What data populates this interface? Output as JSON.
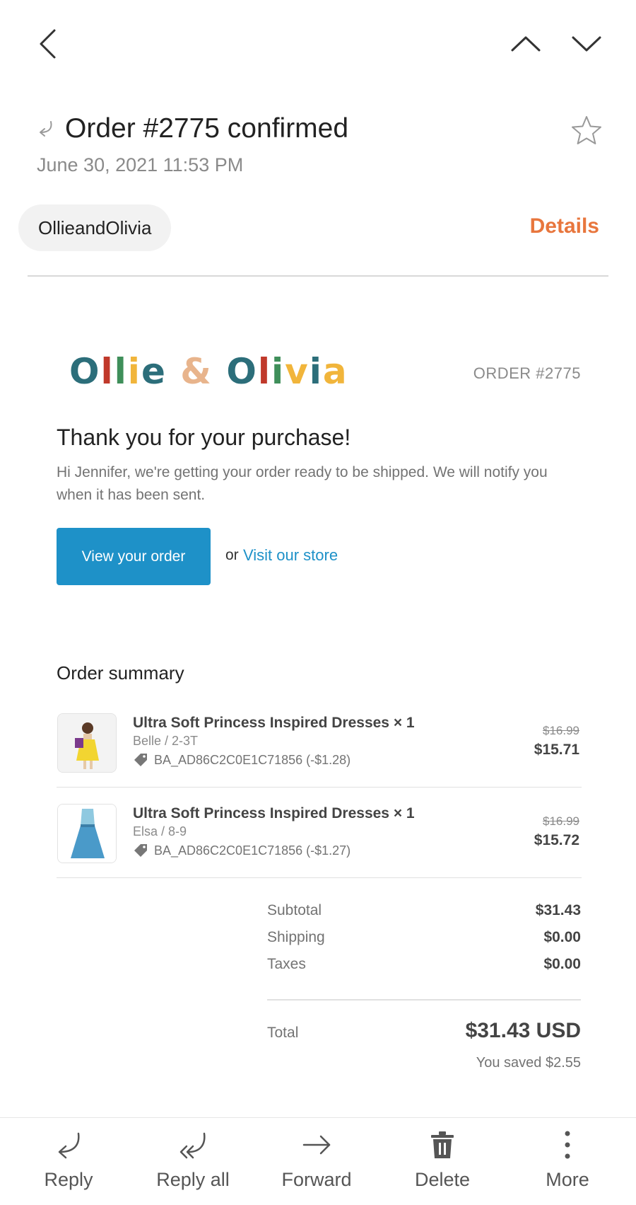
{
  "email": {
    "subject": "Order #2775 confirmed",
    "date": "June 30, 2021  11:53 PM",
    "sender": "OllieandOlivia",
    "details_label": "Details"
  },
  "message": {
    "logo": {
      "text": "Ollie & Olivia",
      "letter_colors": [
        "#2c6e7a",
        "#c0392b",
        "#3f8f5a",
        "#f1b53b",
        "#2c6e7a",
        "#e8b48c",
        "#2c6e7a",
        "#c0392b",
        "#3f8f5a",
        "#f1b53b",
        "#2c6e7a",
        "#f1b53b"
      ]
    },
    "order_label": "ORDER #2775",
    "heading": "Thank you for your purchase!",
    "body": "Hi Jennifer, we're getting your order ready to be shipped. We will notify you when it has been sent.",
    "view_order_label": "View your order",
    "or_text": "or",
    "store_link_label": "Visit our store",
    "summary_title": "Order summary",
    "items": [
      {
        "name": "Ultra Soft Princess Inspired Dresses × 1",
        "variant": "Belle / 2-3T",
        "discount": "BA_AD86C2C0E1C71856 (-$1.28)",
        "original_price": "$16.99",
        "price": "$15.71",
        "image": "girl-in-yellow-dress-thumbnail"
      },
      {
        "name": "Ultra Soft Princess Inspired Dresses × 1",
        "variant": "Elsa / 8-9",
        "discount": "BA_AD86C2C0E1C71856 (-$1.27)",
        "original_price": "$16.99",
        "price": "$15.72",
        "image": "blue-dress-thumbnail"
      }
    ],
    "totals": {
      "subtotal_label": "Subtotal",
      "subtotal": "$31.43",
      "shipping_label": "Shipping",
      "shipping": "$0.00",
      "taxes_label": "Taxes",
      "taxes": "$0.00",
      "total_label": "Total",
      "total": "$31.43 USD",
      "saved": "You saved $2.55"
    }
  },
  "actions": {
    "reply": "Reply",
    "reply_all": "Reply all",
    "forward": "Forward",
    "delete": "Delete",
    "more": "More"
  },
  "colors": {
    "accent": "#e8763d",
    "button": "#1e91c8",
    "link": "#1e91c8"
  },
  "icons": [
    "back-arrow-icon",
    "chevron-up-icon",
    "chevron-down-icon",
    "reply-icon",
    "star-icon",
    "tag-icon",
    "reply-all-icon",
    "forward-icon",
    "trash-icon",
    "more-vertical-icon"
  ]
}
